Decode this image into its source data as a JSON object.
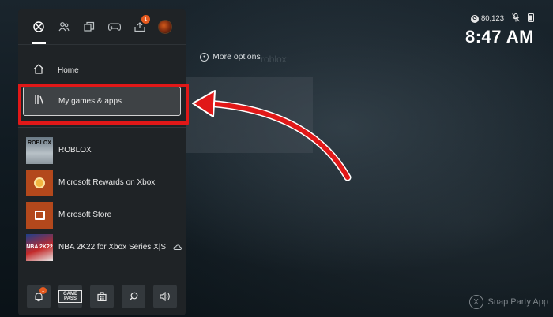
{
  "background": {
    "more_options_label": "More options",
    "faded_title": "roblox"
  },
  "status": {
    "gamerscore": "80,123",
    "time": "8:47 AM"
  },
  "guide": {
    "tabs": [
      {
        "name": "xbox-logo-icon",
        "active": true
      },
      {
        "name": "people-icon"
      },
      {
        "name": "multiplayer-icon"
      },
      {
        "name": "controller-icon"
      },
      {
        "name": "upload-icon",
        "badge": "1"
      },
      {
        "name": "avatar"
      }
    ],
    "menu": {
      "home_label": "Home",
      "my_games_label": "My games & apps"
    },
    "apps": [
      {
        "tile_text": "ROBLOX",
        "label": "ROBLOX"
      },
      {
        "label": "Microsoft Rewards on Xbox"
      },
      {
        "label": "Microsoft Store"
      },
      {
        "tile_text": "NBA 2K22",
        "label": "NBA 2K22 for Xbox Series X|S",
        "cloud": true
      }
    ],
    "bottom": {
      "notification_badge": "1",
      "gamepass_label": "GAME PASS"
    }
  },
  "snap": {
    "label": "Snap Party App"
  },
  "colors": {
    "highlight": "#e11818",
    "accent": "#e65a1f",
    "panel": "#1f2326"
  }
}
